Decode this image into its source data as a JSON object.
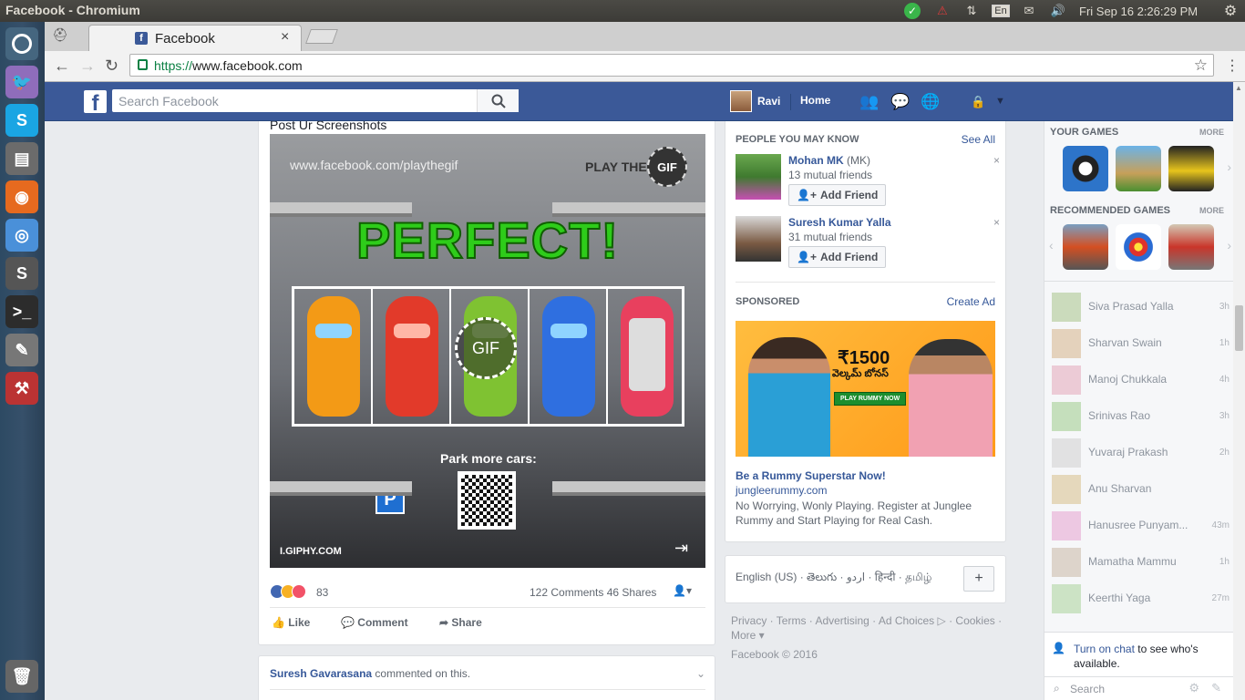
{
  "os": {
    "window_title": "Facebook - Chromium",
    "lang": "En",
    "clock": "Fri Sep 16  2:26:29 PM"
  },
  "browser": {
    "tab_title": "Facebook",
    "url_scheme": "https://",
    "url_host": "www.facebook.com"
  },
  "fb": {
    "search_placeholder": "Search Facebook",
    "user_name": "Ravi",
    "home_label": "Home"
  },
  "post": {
    "title": "Post Ur Screenshots",
    "gif_watermark": "www.facebook.com/playthegif",
    "gif_play_the": "PLAY THE",
    "gif_badge": "GIF",
    "gif_headline": "PERFECT!",
    "gif_center": "GIF",
    "gif_park": "Park more cars:",
    "gif_parking_sign": "P",
    "gif_source": "I.GIPHY.COM",
    "reactions_count": "83",
    "comments_shares": "122 Comments   46 Shares",
    "like_label": "Like",
    "comment_label": "Comment",
    "share_label": "Share"
  },
  "comment_notice": {
    "name": "Suresh Gavarasana",
    "text": " commented on this."
  },
  "pymk": {
    "header": "PEOPLE YOU MAY KNOW",
    "see_all": "See All",
    "people": [
      {
        "name": "Mohan MK",
        "alt": " (MK)",
        "mutual": "13 mutual friends",
        "button": "Add Friend"
      },
      {
        "name": "Suresh Kumar Yalla",
        "alt": "",
        "mutual": "31 mutual friends",
        "button": "Add Friend"
      }
    ],
    "sponsored_header": "SPONSORED",
    "create_ad": "Create Ad",
    "ad_amount": "₹1500",
    "ad_telugu": "వెల్కమ్ బోనస్",
    "ad_play": "PLAY RUMMY NOW",
    "ad_title": "Be a Rummy Superstar Now!",
    "ad_domain": "jungleerummy.com",
    "ad_desc": "No Worrying, Wonly Playing. Register at Junglee Rummy and Start Playing for Real Cash."
  },
  "footer": {
    "languages": "English (US) · తెలుగు · اردو · हिन्दी · தமிழ்",
    "add": "+",
    "links": "Privacy · Terms · Advertising · Ad Choices ▷ · Cookies · More ▾",
    "copyright": "Facebook © 2016"
  },
  "sidebar": {
    "your_games": "YOUR GAMES",
    "recommended_games": "RECOMMENDED GAMES",
    "more": "MORE",
    "friends": [
      {
        "name": "Siva Prasad Yalla",
        "time": "3h"
      },
      {
        "name": "Sharvan Swain",
        "time": "1h"
      },
      {
        "name": "Manoj Chukkala",
        "time": "4h"
      },
      {
        "name": "Srinivas Rao",
        "time": "3h"
      },
      {
        "name": "Yuvaraj Prakash",
        "time": "2h"
      },
      {
        "name": "Anu Sharvan",
        "time": ""
      },
      {
        "name": "Hanusree Punyam...",
        "time": "43m"
      },
      {
        "name": "Mamatha Mammu",
        "time": "1h"
      },
      {
        "name": "Keerthi Yaga",
        "time": "27m"
      }
    ],
    "chat_link": "Turn on chat",
    "chat_text": " to see who's available.",
    "search_placeholder": "Search"
  }
}
